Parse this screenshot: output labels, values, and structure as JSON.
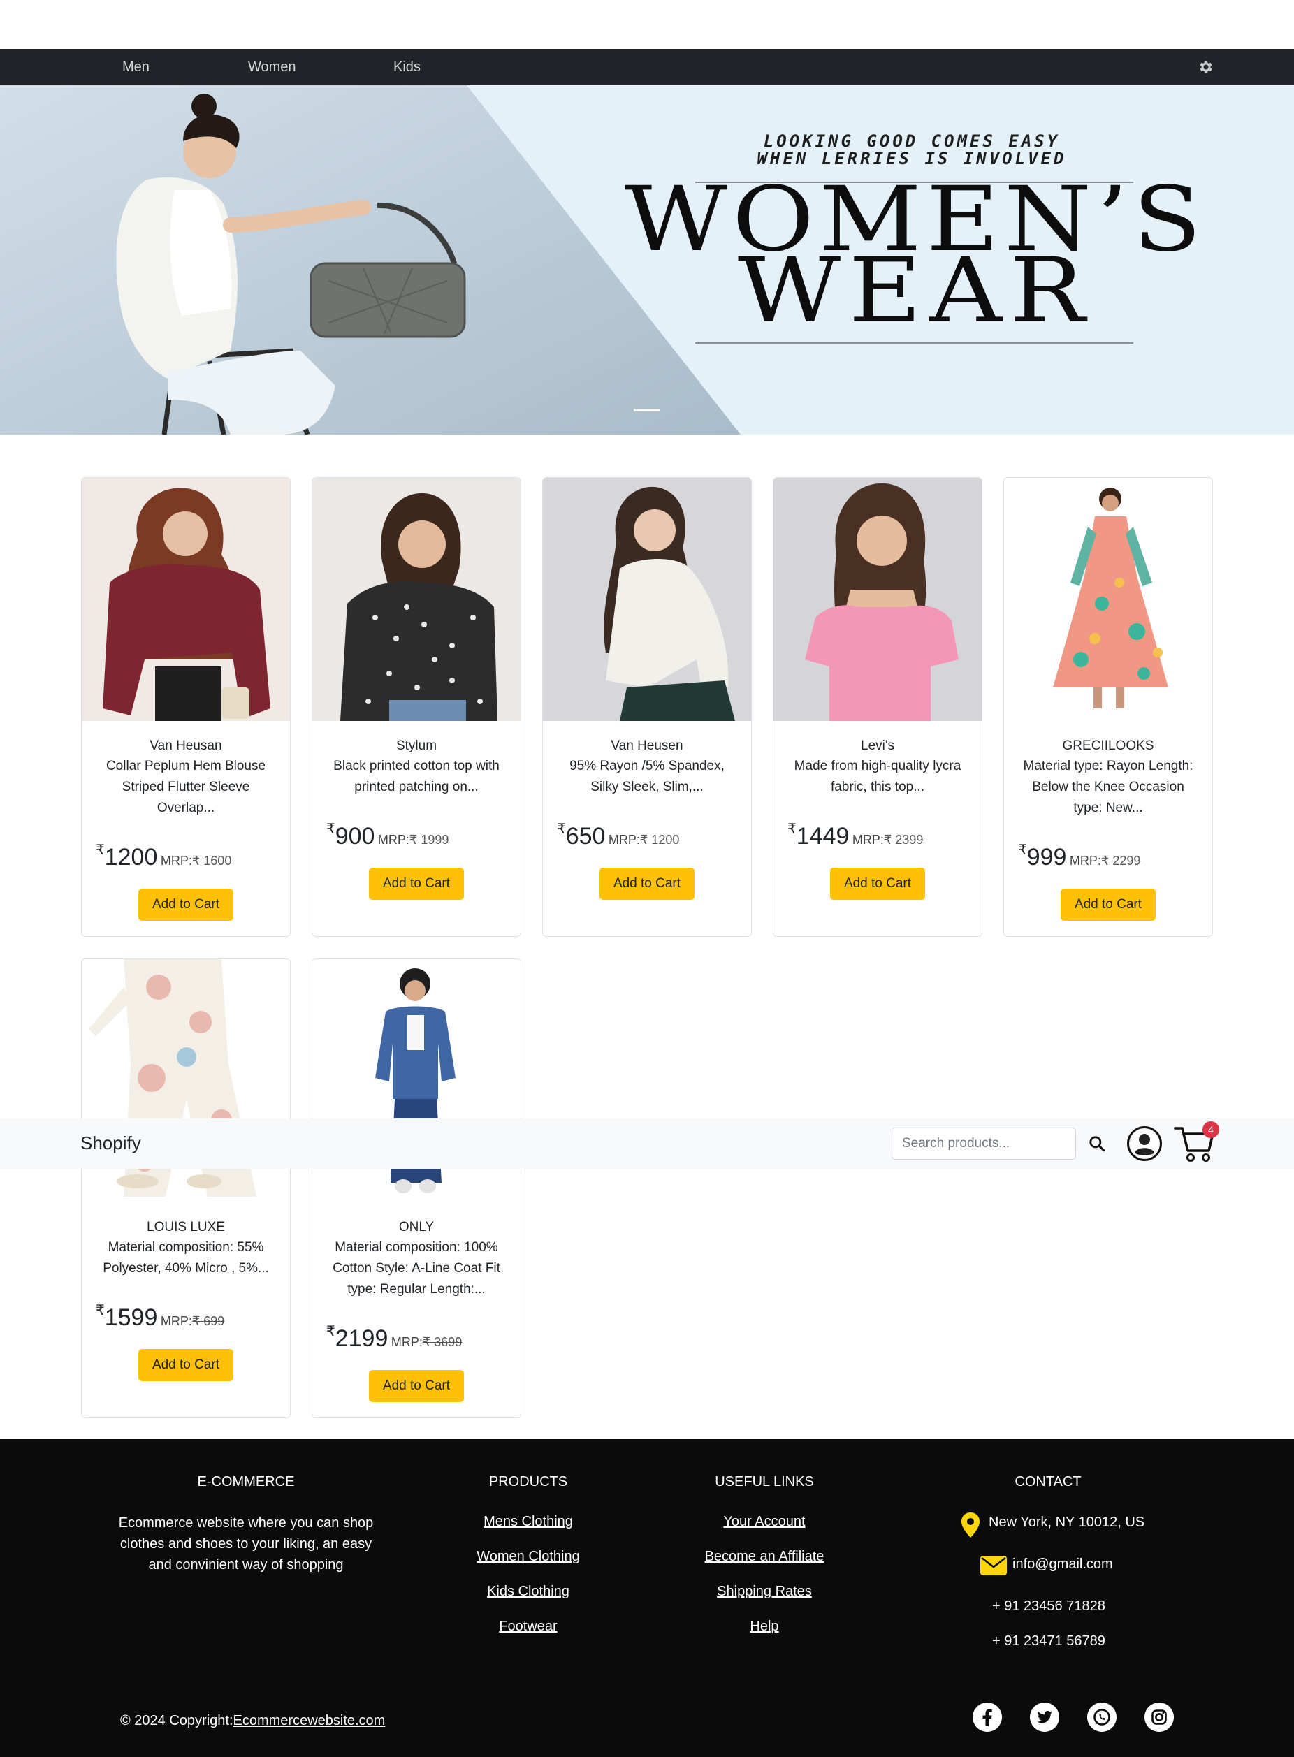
{
  "category_nav": {
    "items": [
      "Men",
      "Women",
      "Kids"
    ],
    "settings_icon": "gear-icon"
  },
  "hero": {
    "tagline_line1": "LOOKING GOOD COMES EASY",
    "tagline_line2": "WHEN LERRIES IS INVOLVED",
    "headline_line1": "WOMEN’S",
    "headline_line2": "WEAR",
    "active_slide": 1,
    "slide_count": 1
  },
  "products": [
    {
      "brand": "Van Heusan",
      "desc": "Collar Peplum Hem Blouse Striped Flutter Sleeve Overlap...",
      "currency": "₹",
      "price": "1200",
      "mrp_label": "MRP:",
      "mrp": "₹ 1600",
      "button": "Add to Cart"
    },
    {
      "brand": "Stylum",
      "desc": "Black printed cotton top with printed patching on...",
      "currency": "₹",
      "price": "900",
      "mrp_label": "MRP:",
      "mrp": "₹ 1999",
      "button": "Add to Cart"
    },
    {
      "brand": "Van Heusen",
      "desc": "95% Rayon /5% Spandex, Silky Sleek, Slim,...",
      "currency": "₹",
      "price": "650",
      "mrp_label": "MRP:",
      "mrp": "₹ 1200",
      "button": "Add to Cart"
    },
    {
      "brand": "Levi's",
      "desc": "Made from high-quality lycra fabric, this top...",
      "currency": "₹",
      "price": "1449",
      "mrp_label": "MRP:",
      "mrp": "₹ 2399",
      "button": "Add to Cart"
    },
    {
      "brand": "GRECIILOOKS",
      "desc": "Material type: Rayon Length: Below the Knee Occasion type: New...",
      "currency": "₹",
      "price": "999",
      "mrp_label": "MRP:",
      "mrp": "₹ 2299",
      "button": "Add to Cart"
    },
    {
      "brand": "LOUIS LUXE",
      "desc": "Material composition: 55% Polyester, 40% Micro , 5%...",
      "currency": "₹",
      "price": "1599",
      "mrp_label": "MRP:",
      "mrp": "₹ 699",
      "button": "Add to Cart"
    },
    {
      "brand": "ONLY",
      "desc": "Material composition: 100% Cotton Style: A-Line Coat Fit type: Regular Length:...",
      "currency": "₹",
      "price": "2199",
      "mrp_label": "MRP:",
      "mrp": "₹ 3699",
      "button": "Add to Cart"
    }
  ],
  "appbar": {
    "brand": "Shopify",
    "search_placeholder": "Search products...",
    "search_value": "",
    "cart_count": "4"
  },
  "footer": {
    "ecommerce": {
      "heading": "E-COMMERCE",
      "text": "Ecommerce website where you can shop clothes and shoes to your liking, an easy and convinient way of shopping"
    },
    "products": {
      "heading": "PRODUCTS",
      "links": [
        "Mens Clothing",
        "Women Clothing",
        "Kids Clothing",
        "Footwear"
      ]
    },
    "useful_links": {
      "heading": "USEFUL LINKS",
      "links": [
        "Your Account",
        "Become an Affiliate",
        "Shipping Rates",
        "Help"
      ]
    },
    "contact": {
      "heading": "CONTACT",
      "address": "New York, NY 10012, US",
      "email": "info@gmail.com",
      "phone1": "+ 91 23456 71828",
      "phone2": "+ 91 23471 56789"
    },
    "copyright_prefix": "© 2024 Copyright:",
    "copyright_link": "Ecommercewebsite.com",
    "social_icons": [
      "facebook-icon",
      "twitter-icon",
      "whatsapp-icon",
      "instagram-icon"
    ],
    "accent_color": "#ffd60a"
  },
  "colors": {
    "nav_bg": "#212529",
    "button_bg": "#ffc107",
    "footer_bg": "#0b0b0b",
    "badge_bg": "#dc3545",
    "hero_bg": "#e4f1f9"
  }
}
